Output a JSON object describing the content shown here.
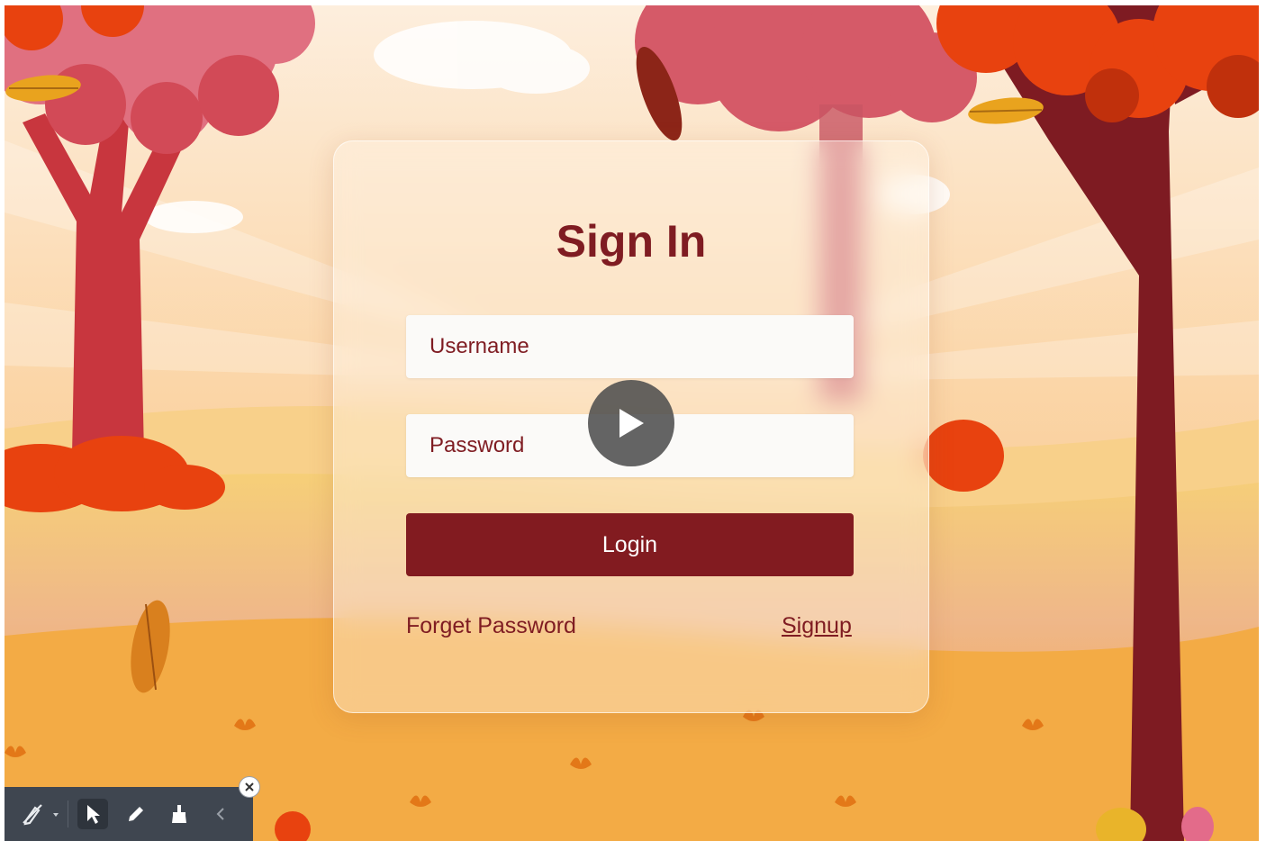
{
  "login": {
    "title": "Sign In",
    "username_placeholder": "Username",
    "password_placeholder": "Password",
    "login_label": "Login",
    "forget_label": "Forget Password",
    "signup_label": "Signup"
  },
  "overlay": {
    "play_icon": "play-icon"
  },
  "toolbar": {
    "icons": [
      "pen-off-icon",
      "dropdown-caret-icon",
      "pointer-icon",
      "pencil-icon",
      "eraser-icon",
      "collapse-chevron-icon",
      "close-icon"
    ]
  },
  "colors": {
    "brand": "#821b20",
    "title": "#7f1c22",
    "tree_trunk": "#7e1b22",
    "foliage_red": "#e86a1a",
    "foliage_pink": "#d55a68",
    "ground": "#f4b24a"
  }
}
